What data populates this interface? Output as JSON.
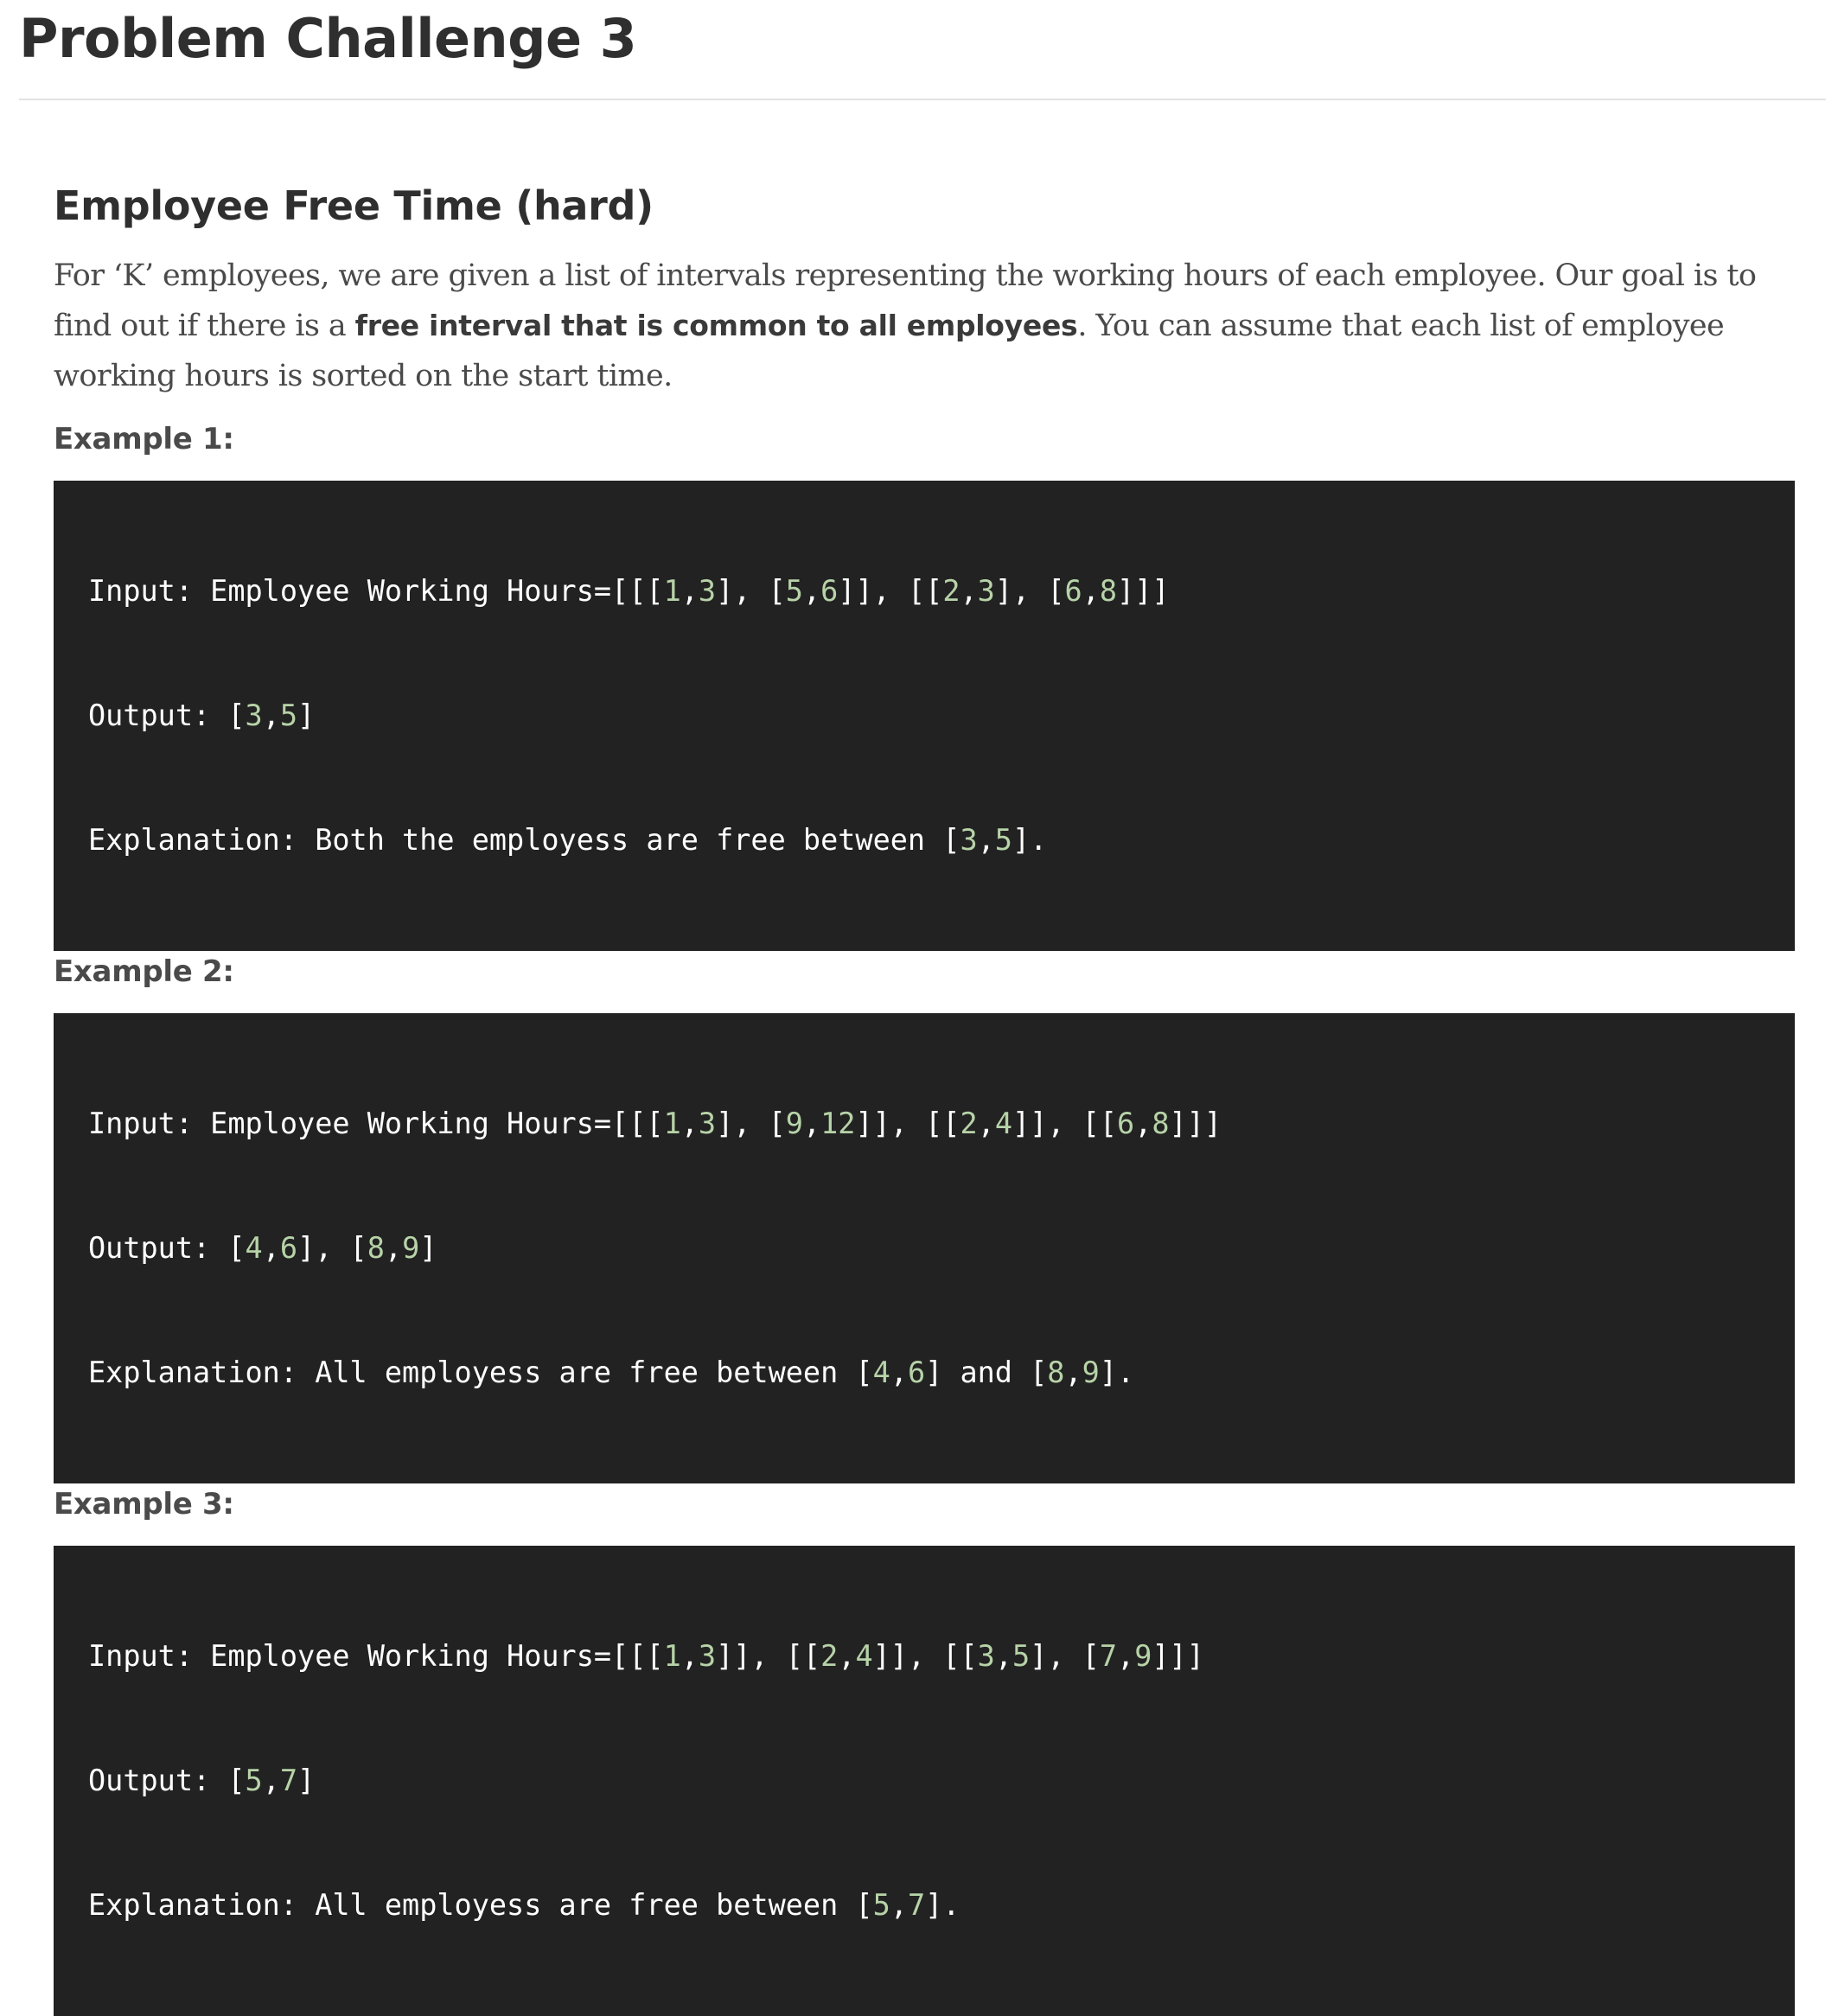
{
  "page": {
    "title": "Problem Challenge 3"
  },
  "problem": {
    "title": "Employee Free Time (hard)",
    "description_part1": "For ‘K’ employees, we are given a list of intervals representing the working hours of each employee. Our goal is to find out if there is a ",
    "description_bold": "free interval that is common to all employees",
    "description_part2": ". You can assume that each list of employee working hours is sorted on the start time."
  },
  "examples": [
    {
      "label": "Example 1:",
      "lines": [
        "Input: Employee Working Hours=[[[1,3], [5,6]], [[2,3], [6,8]]]",
        "Output: [3,5]",
        "Explanation: Both the employess are free between [3,5]."
      ]
    },
    {
      "label": "Example 2:",
      "lines": [
        "Input: Employee Working Hours=[[[1,3], [9,12]], [[2,4]], [[6,8]]]",
        "Output: [4,6], [8,9]",
        "Explanation: All employess are free between [4,6] and [8,9]."
      ]
    },
    {
      "label": "Example 3:",
      "lines": [
        "Input: Employee Working Hours=[[[1,3]], [[2,4]], [[3,5], [7,9]]]",
        "Output: [5,7]",
        "Explanation: All employess are free between [5,7]."
      ]
    }
  ],
  "colors": {
    "code_background": "#222222",
    "code_text": "#ffffff",
    "code_number": "#b7d3a8",
    "heading_text": "#2f2f2f",
    "body_text": "#4a4a4a"
  }
}
